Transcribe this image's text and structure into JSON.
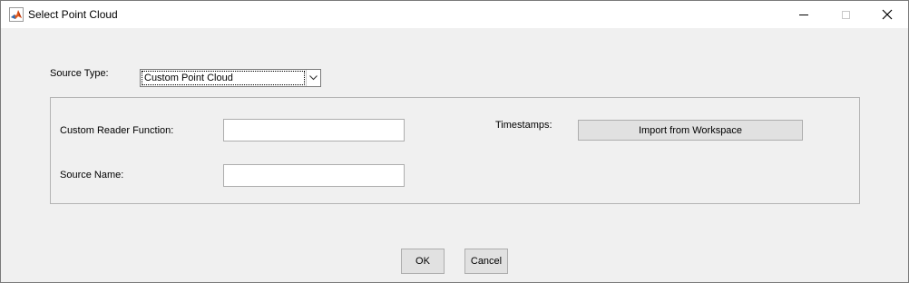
{
  "window": {
    "title": "Select Point Cloud",
    "icon": "matlab-icon",
    "controls": [
      "minimize-icon",
      "maximize-icon",
      "close-icon"
    ]
  },
  "source": {
    "label": "Source Type:",
    "selected": "Custom Point Cloud"
  },
  "panel": {
    "custom_reader_label": "Custom Reader Function:",
    "custom_reader_value": "",
    "source_name_label": "Source Name:",
    "source_name_value": "",
    "timestamps_label": "Timestamps:",
    "import_button": "Import from Workspace"
  },
  "footer": {
    "ok": "OK",
    "cancel": "Cancel"
  }
}
